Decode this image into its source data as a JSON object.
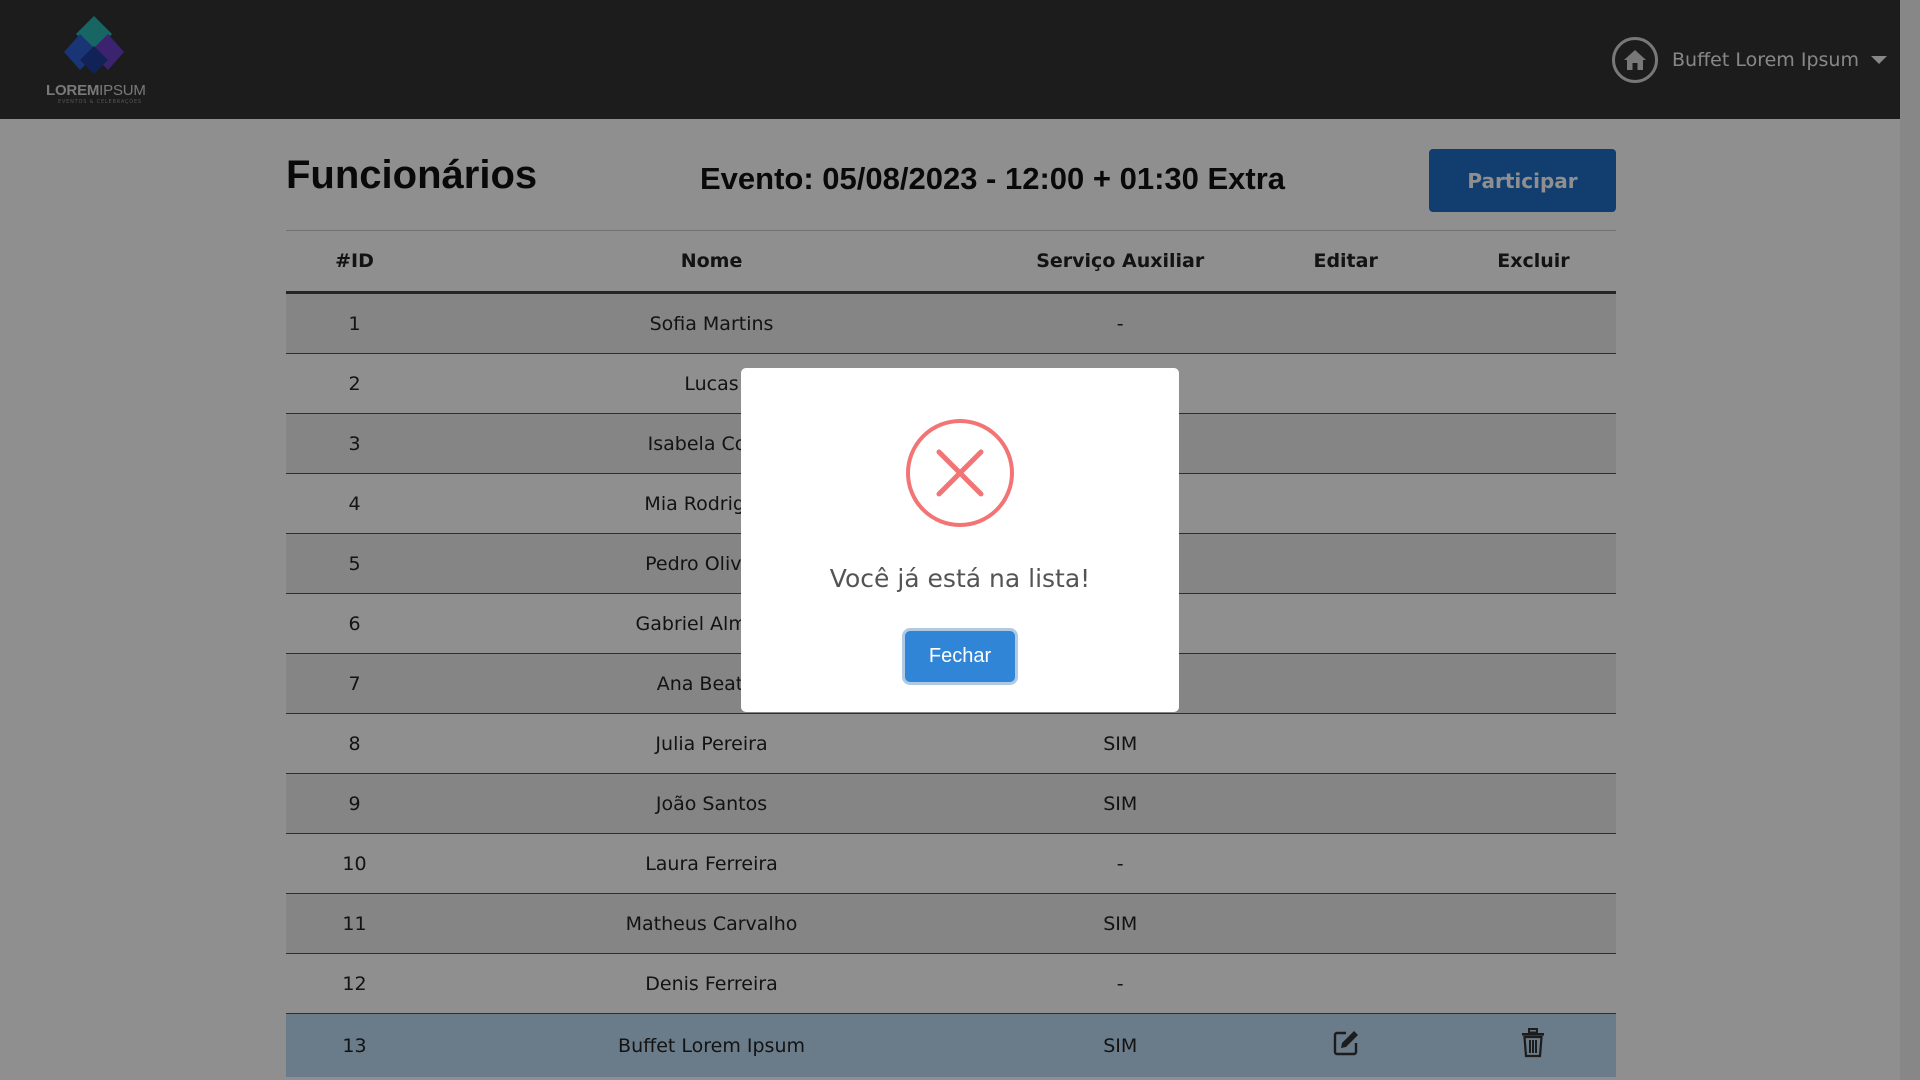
{
  "header": {
    "logo": {
      "text_bold": "LOREM",
      "text_light": "IPSUM",
      "subtext": "EVENTOS & CELEBRAÇÕES"
    },
    "user": {
      "name": "Buffet Lorem Ipsum",
      "icon": "home-icon"
    }
  },
  "page": {
    "title": "Funcionários",
    "event": "Evento: 05/08/2023 - 12:00 + 01:30 Extra",
    "participate_label": "Participar"
  },
  "table": {
    "columns": {
      "id": "#ID",
      "name": "Nome",
      "aux": "Serviço Auxiliar",
      "edit": "Editar",
      "delete": "Excluir"
    },
    "rows": [
      {
        "id": "1",
        "name": "Sofia Martins",
        "aux": "-"
      },
      {
        "id": "2",
        "name": "Lucas",
        "aux": ""
      },
      {
        "id": "3",
        "name": "Isabela Costa",
        "aux": ""
      },
      {
        "id": "4",
        "name": "Mia Rodrigues",
        "aux": ""
      },
      {
        "id": "5",
        "name": "Pedro Oliveira",
        "aux": ""
      },
      {
        "id": "6",
        "name": "Gabriel Almeida",
        "aux": ""
      },
      {
        "id": "7",
        "name": "Ana Beatriz",
        "aux": ""
      },
      {
        "id": "8",
        "name": "Julia Pereira",
        "aux": "SIM"
      },
      {
        "id": "9",
        "name": "João Santos",
        "aux": "SIM"
      },
      {
        "id": "10",
        "name": "Laura Ferreira",
        "aux": "-"
      },
      {
        "id": "11",
        "name": "Matheus Carvalho",
        "aux": "SIM"
      },
      {
        "id": "12",
        "name": "Denis Ferreira",
        "aux": "-"
      },
      {
        "id": "13",
        "name": "Buffet Lorem Ipsum",
        "aux": "SIM"
      }
    ]
  },
  "modal": {
    "icon": "error-x-icon",
    "message": "Você já está na lista!",
    "close_label": "Fechar"
  },
  "colors": {
    "header_bg": "#323232",
    "primary_button": "#1f6fc6",
    "modal_button": "#3085d6",
    "error_icon": "#f27474",
    "highlight_row": "#bedcf6"
  }
}
